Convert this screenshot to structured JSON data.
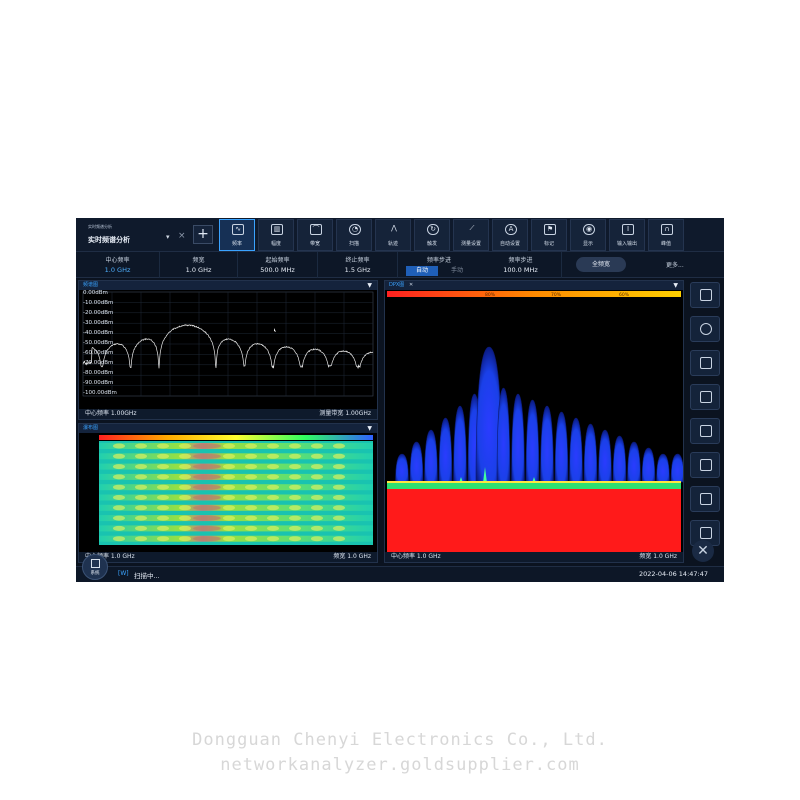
{
  "mode": {
    "sub_label": "实时频谱分析",
    "title": "实时频谱分析",
    "add_label": "+"
  },
  "toolbar": [
    {
      "label": "频率",
      "icon": "waveform-icon",
      "active": true
    },
    {
      "label": "幅度",
      "icon": "bar-chart-icon",
      "active": false
    },
    {
      "label": "带宽",
      "icon": "bandwidth-icon",
      "active": false
    },
    {
      "label": "扫描",
      "icon": "clock-icon",
      "active": false
    },
    {
      "label": "轨迹",
      "icon": "trace-icon",
      "active": false
    },
    {
      "label": "触发",
      "icon": "trigger-icon",
      "active": false
    },
    {
      "label": "测量设置",
      "icon": "ruler-icon",
      "active": false
    },
    {
      "label": "自动设置",
      "icon": "auto-icon",
      "active": false
    },
    {
      "label": "标记",
      "icon": "marker-icon",
      "active": false
    },
    {
      "label": "显示",
      "icon": "eye-icon",
      "active": false
    },
    {
      "label": "输入输出",
      "icon": "io-icon",
      "active": false
    },
    {
      "label": "峰值",
      "icon": "peak-icon",
      "active": false
    }
  ],
  "params": {
    "center_freq": {
      "label": "中心频率",
      "value": "1.0 GHz"
    },
    "span": {
      "label": "频宽",
      "value": "1.0 GHz"
    },
    "start_freq": {
      "label": "起始频率",
      "value": "500.0 MHz"
    },
    "stop_freq": {
      "label": "终止频率",
      "value": "1.5 GHz"
    },
    "freq_step": {
      "label": "频率步进",
      "auto": "自动",
      "manual": "手动"
    },
    "step_size": {
      "label": "频率步进",
      "value": "100.0 MHz"
    },
    "full_span": "全频宽",
    "more": "更多..."
  },
  "spectrum": {
    "title": "频谱图",
    "y_labels": [
      "0.00dBm",
      "-10.00dBm",
      "-20.00dBm",
      "-30.00dBm",
      "-40.00dBm",
      "-50.00dBm",
      "-60.00dBm",
      "-70.00dBm",
      "-80.00dBm",
      "-90.00dBm",
      "-100.00dBm"
    ],
    "footer_left": "中心频率 1.00GHz",
    "footer_right": "测量带宽 1.00GHz"
  },
  "waterfall": {
    "title": "瀑布图",
    "footer_left": "中心频率 1.0 GHz",
    "footer_right": "频宽 1.0 GHz"
  },
  "dpx": {
    "title": "DPX图",
    "scale_labels": [
      "80%",
      "70%",
      "60%"
    ],
    "footer_left": "中心频率 1.0 GHz",
    "footer_right": "频宽 1.0 GHz"
  },
  "sidebar": [
    {
      "icon": "print-icon"
    },
    {
      "icon": "refresh-icon"
    },
    {
      "icon": "sync-icon"
    },
    {
      "icon": "save-icon"
    },
    {
      "icon": "folder-icon"
    },
    {
      "icon": "screenshot-icon"
    },
    {
      "icon": "printer-icon"
    },
    {
      "icon": "report-icon"
    }
  ],
  "status": {
    "system_label": "系统",
    "tag": "[W]",
    "text": "扫描中...",
    "time": "2022-04-06 14:47:47"
  },
  "colors": {
    "accent": "#3aa3ff",
    "trace": "#e8e8e8",
    "dpx_blue": "#1f4dff",
    "dpx_red": "#ff1a1a"
  },
  "watermark": {
    "line1": "Dongguan Chenyi Electronics Co., Ltd.",
    "line2": "networkanalyzer.goldsupplier.com"
  }
}
